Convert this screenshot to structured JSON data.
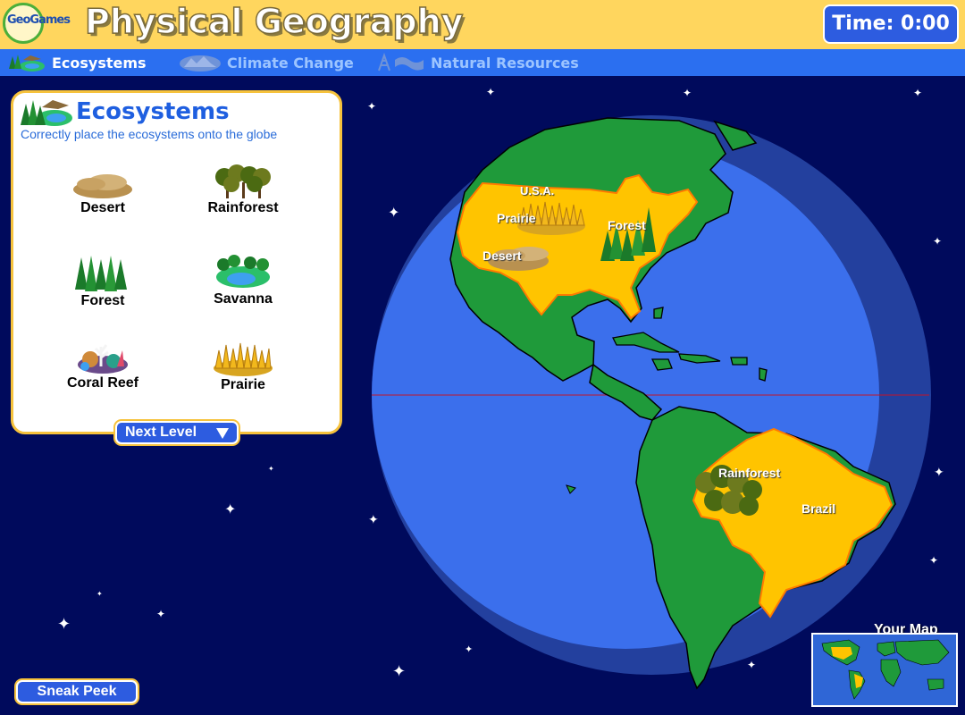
{
  "header": {
    "logo_text": "GeoGames",
    "title": "Physical Geography",
    "timer": "Time: 0:00"
  },
  "tabs": [
    {
      "label": "Ecosystems",
      "active": true
    },
    {
      "label": "Climate Change",
      "active": false
    },
    {
      "label": "Natural Resources",
      "active": false
    }
  ],
  "panel": {
    "title": "Ecosystems",
    "subtitle": "Correctly place the ecosystems onto the globe",
    "items": [
      {
        "label": "Desert",
        "icon": "desert-icon"
      },
      {
        "label": "Rainforest",
        "icon": "rainforest-icon"
      },
      {
        "label": "Forest",
        "icon": "forest-icon"
      },
      {
        "label": "Savanna",
        "icon": "savanna-icon"
      },
      {
        "label": "Coral Reef",
        "icon": "coral-reef-icon"
      },
      {
        "label": "Prairie",
        "icon": "prairie-icon"
      }
    ],
    "next_button": "Next Level"
  },
  "globe": {
    "countries": [
      "U.S.A.",
      "Brazil"
    ],
    "placed": [
      "Prairie",
      "Forest",
      "Desert",
      "Rainforest"
    ]
  },
  "sneak_peek": "Sneak Peek",
  "minimap_label": "Your Map",
  "colors": {
    "header_bg": "#ffd65e",
    "tab_bar": "#2b6ff0",
    "space": "#000a5c",
    "ocean": "#3b6fec",
    "land": "#1f9a3a",
    "highlight_country": "#ffc400",
    "button": "#2d5ce0"
  }
}
